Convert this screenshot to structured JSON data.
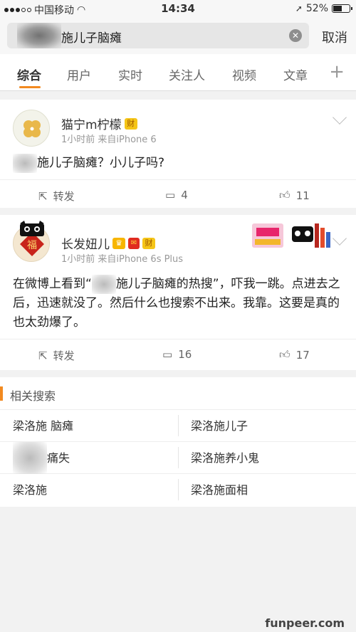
{
  "status_bar": {
    "carrier": "中国移动",
    "time": "14:34",
    "battery": "52%"
  },
  "search": {
    "query": "施儿子脑瘫",
    "cancel_label": "取消"
  },
  "tabs": [
    {
      "label": "综合"
    },
    {
      "label": "用户"
    },
    {
      "label": "实时"
    },
    {
      "label": "关注人"
    },
    {
      "label": "视频"
    },
    {
      "label": "文章"
    }
  ],
  "tab_add": "+",
  "posts": [
    {
      "author": "猫宁m柠檬",
      "badge": "财",
      "meta": "1小时前  来自iPhone 6",
      "text": "施儿子脑瘫？小儿子吗?",
      "repost_label": "转发",
      "comments": "4",
      "likes": "11"
    },
    {
      "author": "长发妞儿",
      "badge": "财",
      "meta": "1小时前  来自iPhone 6s Plus",
      "text_before": "在微博上看到“",
      "text_after": "施儿子脑瘫的热搜”，吓我一跳。点进去之后，迅速就没了。然后什么也搜索不出来。我靠。这要是真的也太劲爆了。",
      "repost_label": "转发",
      "comments": "16",
      "likes": "17"
    }
  ],
  "related": {
    "title": "相关搜索",
    "items": [
      "梁洛施 脑瘫",
      "梁洛施儿子",
      "痛失",
      "梁洛施养小鬼",
      "梁洛施",
      "梁洛施面相"
    ]
  },
  "watermark": "funpeer.com",
  "colors": {
    "accent": "#f28a20",
    "background": "#f2f2f2"
  }
}
